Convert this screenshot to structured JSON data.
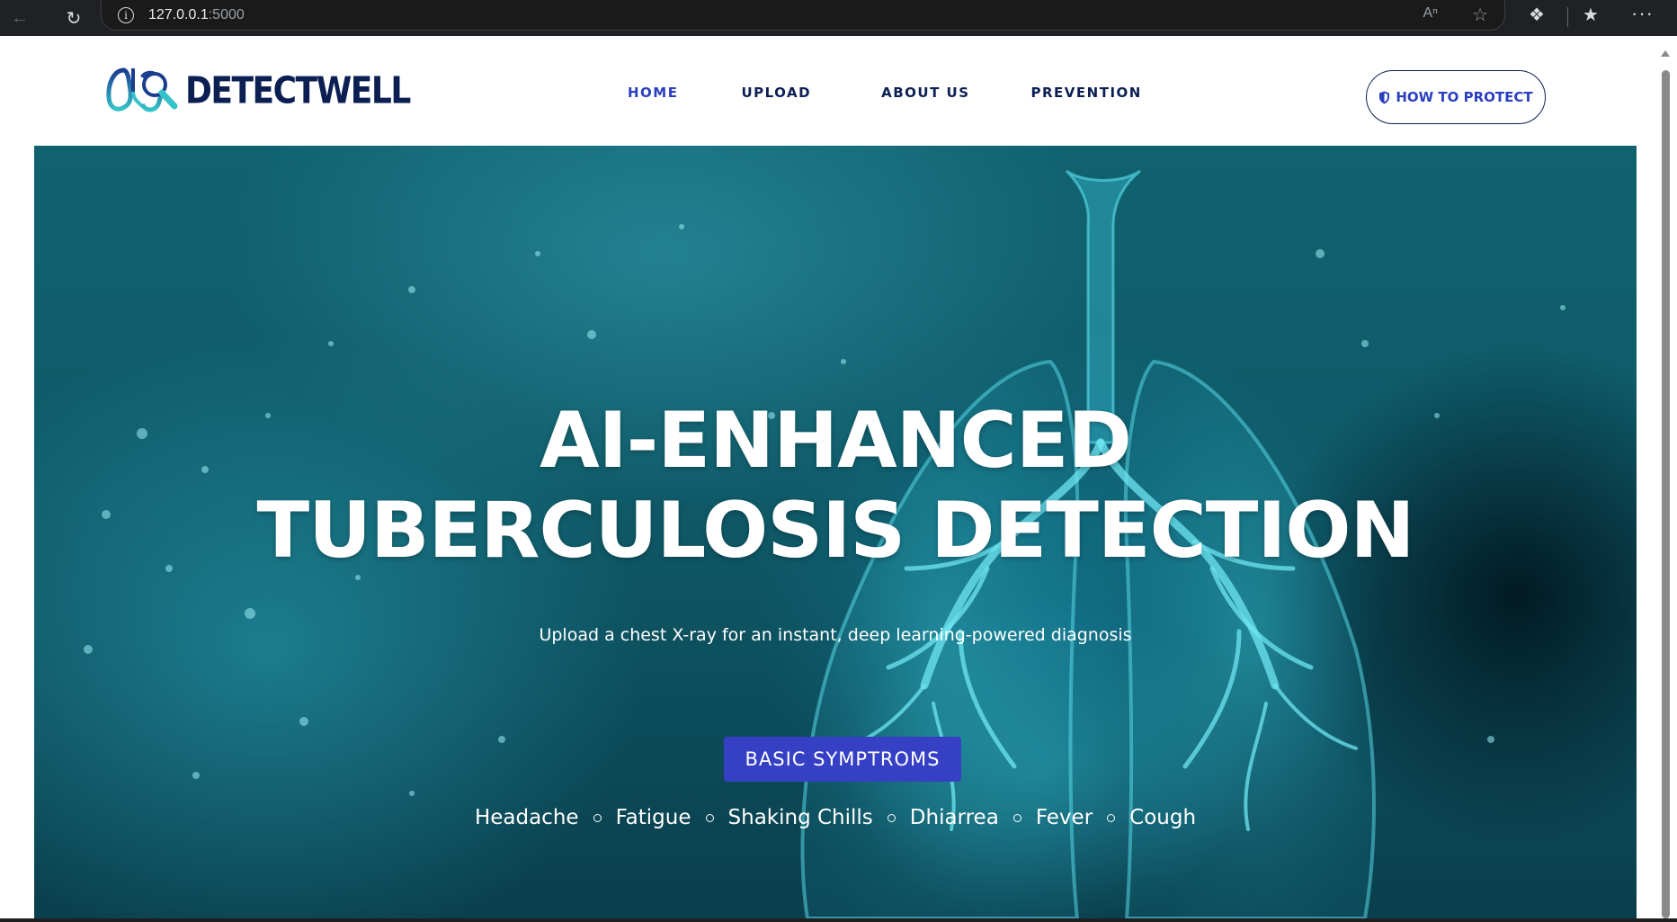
{
  "browser": {
    "url_host": "127.0.0.1",
    "url_port": ":5000"
  },
  "brand": {
    "name": "DETECTWELL",
    "color": "#0b1f53",
    "accent": "#2a3fc0"
  },
  "nav": {
    "items": [
      {
        "label": "HOME",
        "active": true
      },
      {
        "label": "UPLOAD",
        "active": false
      },
      {
        "label": "ABOUT US",
        "active": false
      },
      {
        "label": "PREVENTION",
        "active": false
      }
    ],
    "cta": "HOW TO PROTECT"
  },
  "hero": {
    "title_line1": "AI-ENHANCED",
    "title_line2": "TUBERCULOSIS DETECTION",
    "subtitle": "Upload a chest X-ray for an instant, deep learning-powered diagnosis",
    "button": "BASIC SYMPTROMS",
    "button_color": "#3640c4",
    "symptoms": [
      "Headache",
      "Fatigue",
      "Shaking Chills",
      "Dhiarrea",
      "Fever",
      "Cough"
    ]
  }
}
